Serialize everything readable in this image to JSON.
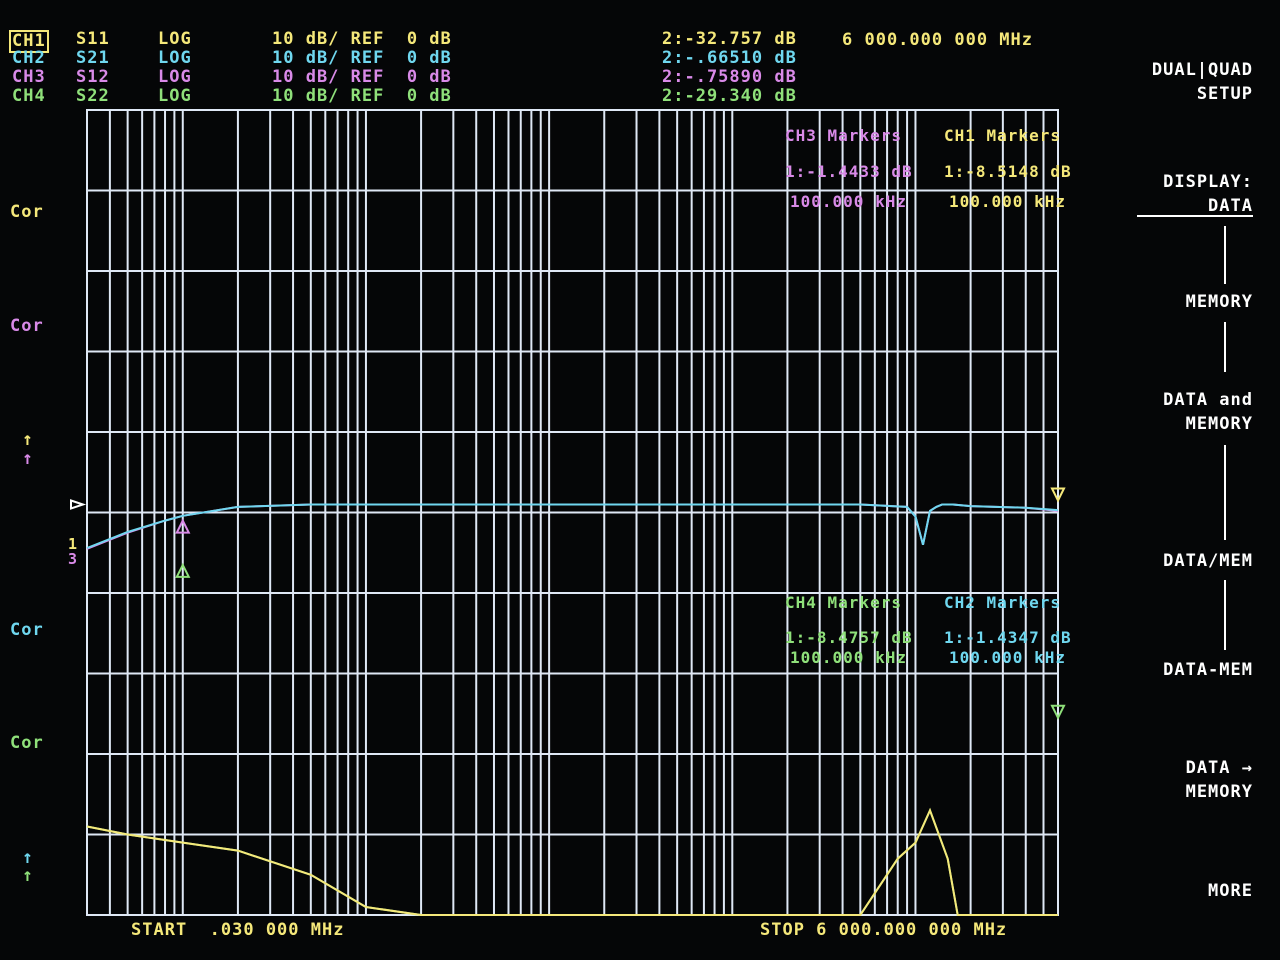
{
  "header": {
    "channels": [
      {
        "ch": "CH1",
        "param": "S11",
        "format": "LOG",
        "scale": "10 dB/ REF  0 dB",
        "marker": "2:-32.757 dB",
        "color": "#f5e87a",
        "selected": true
      },
      {
        "ch": "CH2",
        "param": "S21",
        "format": "LOG",
        "scale": "10 dB/ REF  0 dB",
        "marker": "2:-.66510 dB",
        "color": "#6fd7ef",
        "selected": false
      },
      {
        "ch": "CH3",
        "param": "S12",
        "format": "LOG",
        "scale": "10 dB/ REF  0 dB",
        "marker": "2:-.75890 dB",
        "color": "#d98ae8",
        "selected": false
      },
      {
        "ch": "CH4",
        "param": "S22",
        "format": "LOG",
        "scale": "10 dB/ REF  0 dB",
        "marker": "2:-29.340 dB",
        "color": "#8fe07a",
        "selected": false
      }
    ],
    "frequency": "6 000.000 000 MHz"
  },
  "menu": {
    "title_line1": "DUAL|QUAD",
    "title_line2": "SETUP",
    "display_line1": "DISPLAY:",
    "display_line2": "DATA",
    "memory": "MEMORY",
    "data_and_line1": "DATA and",
    "data_and_line2": "MEMORY",
    "data_div_mem": "DATA/MEM",
    "data_minus_mem": "DATA-MEM",
    "data_to_line1": "DATA →",
    "data_to_line2": "MEMORY",
    "more": "MORE"
  },
  "left": {
    "cor_labels": [
      "Cor",
      "Cor",
      "Cor",
      "Cor"
    ],
    "arrow": "↑",
    "ref_label_a": "1",
    "ref_label_b": "3"
  },
  "markers": {
    "ch3_title": "CH3 Markers",
    "ch1_title": "CH1 Markers",
    "ch3_val": "1:-1.4433 dB",
    "ch1_val": "1:-8.5148 dB",
    "ch3_freq": "100.000 kHz",
    "ch1_freq": "100.000 kHz",
    "ch4_title": "CH4 Markers",
    "ch2_title": "CH2 Markers",
    "ch4_val": "1:-8.4757 dB",
    "ch2_val": "1:-1.4347 dB",
    "ch4_freq": "100.000 kHz",
    "ch2_freq": "100.000 kHz"
  },
  "footer": {
    "start": "START  .030 000 MHz",
    "stop": "STOP 6 000.000 000 MHz"
  },
  "chart_data": {
    "type": "line",
    "x_scale": "log",
    "xlim_mhz": [
      0.03,
      6000
    ],
    "ylim_db": [
      -50,
      0
    ],
    "ylabel": "",
    "xlabel": "",
    "grid": true,
    "series": [
      {
        "name": "S11",
        "color": "#f5e87a",
        "x": [
          0.03,
          0.05,
          0.1,
          0.2,
          0.5,
          1,
          2,
          5,
          10,
          20,
          30,
          50,
          100,
          200,
          300,
          500,
          800,
          1000,
          1200,
          1500,
          1700,
          2000,
          2200,
          2500,
          2800,
          3000,
          3300,
          3600,
          3900,
          4200,
          4500,
          4800,
          5000,
          5300,
          5600,
          6000
        ],
        "y": [
          -40,
          -41,
          -42,
          -43,
          -46,
          -50,
          -56,
          -63,
          -69,
          -75,
          -80,
          -80,
          -80,
          -73,
          -66,
          -56,
          -44,
          -42,
          -38,
          -44,
          -53,
          -63,
          -62,
          -62,
          -63,
          -60,
          -58,
          -59,
          -58,
          -57,
          -59,
          -62,
          -72,
          -66,
          -60,
          -61
        ]
      },
      {
        "name": "S22",
        "color": "#8fe07a",
        "x": [
          0.03,
          0.05,
          0.1,
          0.2,
          0.5,
          1,
          2,
          5,
          10,
          20,
          30,
          50,
          100,
          200,
          300,
          500,
          800,
          1000,
          1200,
          1500,
          1700,
          2000,
          2300,
          2500,
          2800,
          3000,
          3300,
          3600,
          3900,
          4200,
          4500,
          4800,
          5000,
          5300,
          5600,
          6000
        ],
        "y": [
          -40,
          -41,
          -42,
          -43,
          -46,
          -50,
          -56,
          -63,
          -69,
          -75,
          -80,
          -80,
          -80,
          -73,
          -66,
          -56,
          -44,
          -42,
          -38,
          -44,
          -53,
          -60,
          -73,
          -76,
          -64,
          -62,
          -61,
          -63,
          -59,
          -61,
          -64,
          -62,
          -58,
          -60,
          -59,
          -61
        ]
      },
      {
        "name": "S12",
        "color": "#d98ae8",
        "x": [
          0.03,
          0.05,
          0.08,
          0.1,
          0.2,
          0.5,
          1,
          10,
          100,
          500,
          900,
          1000,
          1100,
          1200,
          1300,
          1400,
          1600,
          2000,
          4000,
          6000
        ],
        "y": [
          -5.5,
          -3.5,
          -2,
          -1.4,
          -0.3,
          0,
          0,
          0,
          0,
          0,
          -0.3,
          -1.5,
          -5,
          -0.8,
          -0.3,
          0,
          0,
          -0.2,
          -0.4,
          -0.8
        ]
      },
      {
        "name": "S21",
        "color": "#6fd7ef",
        "x": [
          0.03,
          0.05,
          0.08,
          0.1,
          0.2,
          0.5,
          1,
          10,
          100,
          500,
          900,
          1000,
          1100,
          1200,
          1300,
          1400,
          1600,
          2000,
          4000,
          6000
        ],
        "y": [
          -5.4,
          -3.4,
          -2,
          -1.4,
          -0.3,
          0,
          0,
          0,
          0,
          0,
          -0.3,
          -1.5,
          -5,
          -0.8,
          -0.3,
          0,
          0,
          -0.2,
          -0.4,
          -0.7
        ]
      }
    ]
  }
}
